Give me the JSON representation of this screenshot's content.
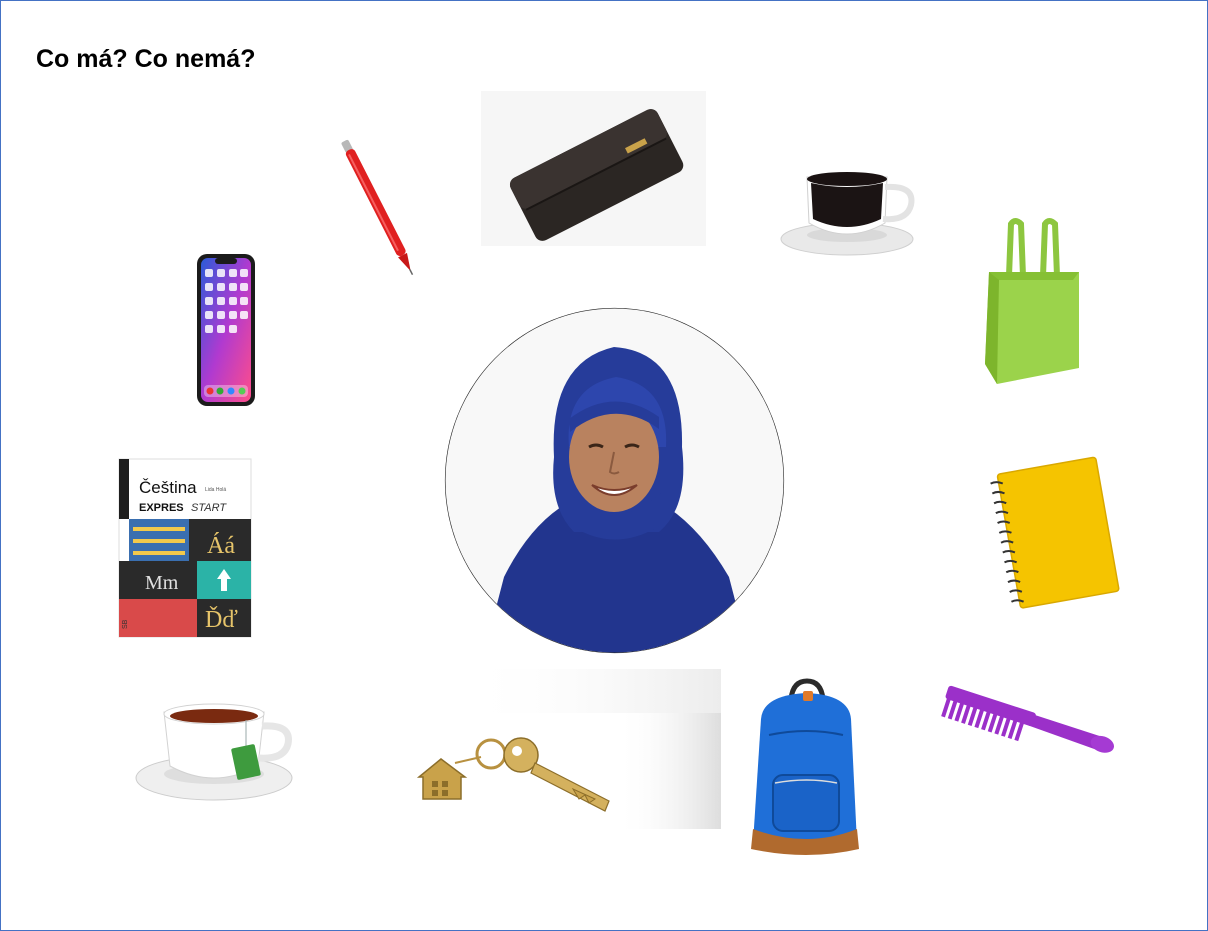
{
  "worksheet": {
    "title": "Co má? Co nemá?"
  },
  "book_cover": {
    "title": "Čeština",
    "small_text": "Lida Holá",
    "subtitle_bold": "EXPRES",
    "subtitle_italic": "START",
    "letters_1": "Áá",
    "letters_2": "Mm",
    "letters_3": "Ďď",
    "spine_text": "SB"
  },
  "center_photo": {
    "icon": "woman-in-hijab-portrait"
  },
  "items": [
    {
      "name": "pen",
      "icon": "red-pen-icon"
    },
    {
      "name": "wallet",
      "icon": "black-wallet-icon"
    },
    {
      "name": "coffee",
      "icon": "coffee-cup-icon"
    },
    {
      "name": "phone",
      "icon": "smartphone-icon"
    },
    {
      "name": "bag",
      "icon": "green-shopping-bag-icon"
    },
    {
      "name": "book",
      "icon": "textbook-icon"
    },
    {
      "name": "notebook",
      "icon": "yellow-notebook-icon"
    },
    {
      "name": "tea",
      "icon": "tea-cup-icon"
    },
    {
      "name": "keys",
      "icon": "house-keychain-icon"
    },
    {
      "name": "backpack",
      "icon": "blue-backpack-icon"
    },
    {
      "name": "comb",
      "icon": "purple-comb-icon"
    }
  ],
  "colors": {
    "border": "#4472c4",
    "pen": "#e02020",
    "bag": "#9bd34b",
    "notebook": "#f5c400",
    "backpack": "#1f6fd8",
    "comb": "#9b30c9",
    "hijab": "#263c9a"
  }
}
